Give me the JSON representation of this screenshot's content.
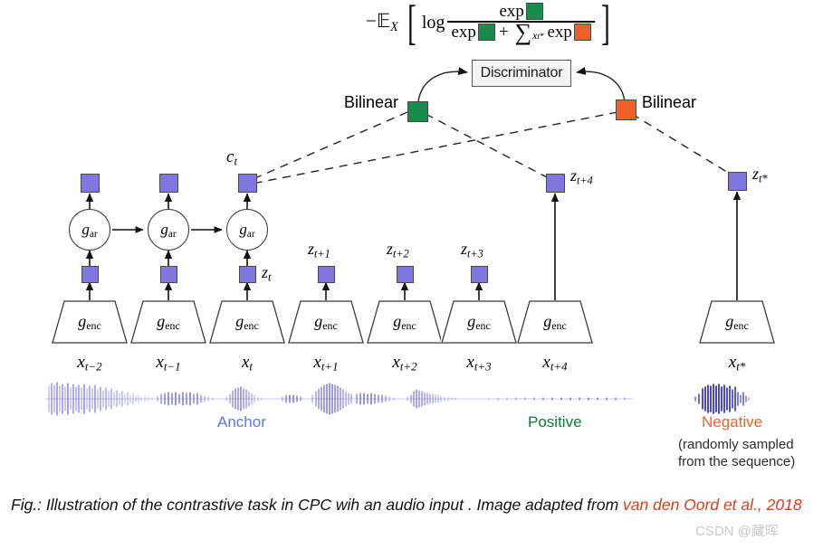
{
  "figure": {
    "title_caption": "Fig.: Illustration of the contrastive task in CPC wih an audio input . Image adapted from ",
    "caption_citation": "van den Oord et al., 2018",
    "watermark": "CSDN @藏晖"
  },
  "formula": {
    "prefix": "−𝔼",
    "prefix_sub": "X",
    "bracket_open": "[",
    "bracket_close": "]",
    "log": "log",
    "numerator_exp": "exp",
    "denominator_exp_1": "exp",
    "plus": "+",
    "sum_symbol": "∑",
    "sum_sub": "x",
    "sum_sub2": "t*",
    "denominator_exp_2": "exp",
    "numerator_color": "#1a8a4d",
    "denom_color_1": "#1a8a4d",
    "denom_color_2": "#ef5f27"
  },
  "discriminator": {
    "label": "Discriminator"
  },
  "bilinear": {
    "left_label": "Bilinear",
    "left_color": "#1a8a4d",
    "right_label": "Bilinear",
    "right_color": "#ef5f27"
  },
  "context": {
    "c_label": "c",
    "c_sub": "t"
  },
  "autoregressive": {
    "node_label": "g",
    "node_sub": "ar",
    "count": 3
  },
  "encoders": [
    {
      "name": "g",
      "sub": "enc",
      "x_label": "x",
      "x_sub": "t−2",
      "z_label": "",
      "z_sub": ""
    },
    {
      "name": "g",
      "sub": "enc",
      "x_label": "x",
      "x_sub": "t−1",
      "z_label": "",
      "z_sub": ""
    },
    {
      "name": "g",
      "sub": "enc",
      "x_label": "x",
      "x_sub": "t",
      "z_label": "z",
      "z_sub": "t"
    },
    {
      "name": "g",
      "sub": "enc",
      "x_label": "x",
      "x_sub": "t+1",
      "z_label": "z",
      "z_sub": "t+1"
    },
    {
      "name": "g",
      "sub": "enc",
      "x_label": "x",
      "x_sub": "t+2",
      "z_label": "z",
      "z_sub": "t+2"
    },
    {
      "name": "g",
      "sub": "enc",
      "x_label": "x",
      "x_sub": "t+3",
      "z_label": "z",
      "z_sub": "t+3"
    },
    {
      "name": "g",
      "sub": "enc",
      "x_label": "x",
      "x_sub": "t+4",
      "z_label": "z",
      "z_sub": "t+4"
    },
    {
      "name": "g",
      "sub": "enc",
      "x_label": "x",
      "x_sub": "t*",
      "z_label": "z",
      "z_sub": "t*"
    }
  ],
  "categories": {
    "anchor": "Anchor",
    "anchor_color": "#5b79e8",
    "positive": "Positive",
    "positive_color": "#0f7a3d",
    "negative": "Negative",
    "negative_color": "#f0612c",
    "negative_note_line1": "(randomly sampled",
    "negative_note_line2": "from the sequence)"
  },
  "colors": {
    "latent_square": "#8076e0",
    "green": "#1a8a4d",
    "orange": "#ef5f27",
    "waveform": "#3a34d6"
  }
}
